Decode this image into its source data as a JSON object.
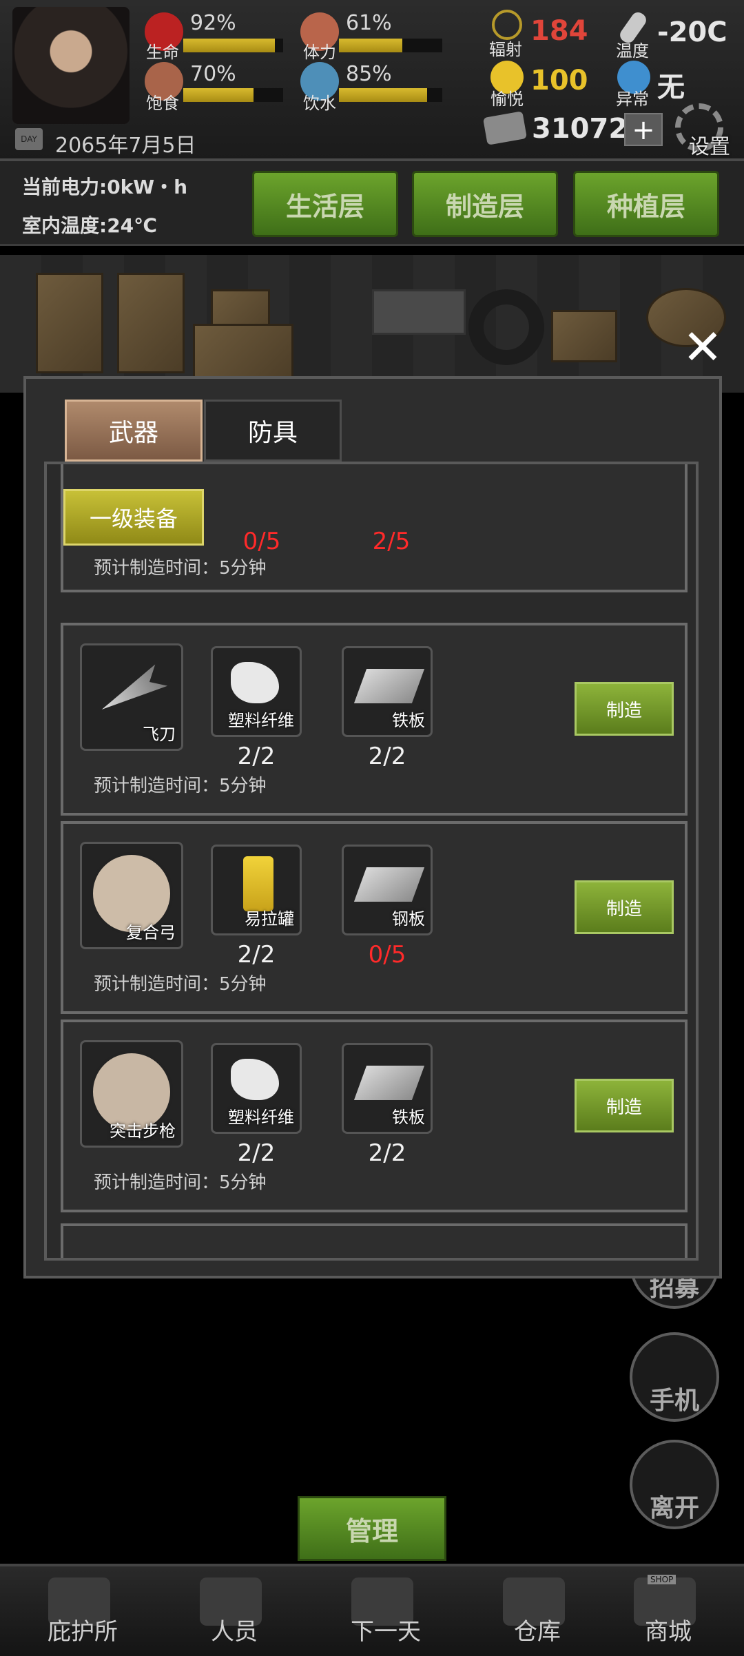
{
  "status": {
    "stats": [
      {
        "label": "生命",
        "percent": "92%",
        "level": 0.92,
        "color": "#c33"
      },
      {
        "label": "体力",
        "percent": "61%",
        "level": 0.61,
        "color": "#c0644a"
      },
      {
        "label": "饱食",
        "percent": "70%",
        "level": 0.7,
        "color": "#b4694a"
      },
      {
        "label": "饮水",
        "percent": "85%",
        "level": 0.85,
        "color": "#5a9fc8"
      }
    ],
    "radiation": {
      "label": "辐射",
      "value": "184"
    },
    "temperature": {
      "label": "温度",
      "value": "-20C"
    },
    "mood": {
      "label": "愉悦",
      "value": "100"
    },
    "abnormal": {
      "label": "异常",
      "value": "无"
    },
    "money": "31072",
    "add_label": "+",
    "settings_label": "设置",
    "date": "2065年7月5日",
    "day_label": "DAY"
  },
  "info": {
    "power": "当前电力:0kW・h",
    "indoor_temp": "室内温度:24℃"
  },
  "floors": [
    "生活层",
    "制造层",
    "种植层"
  ],
  "side_buttons": [
    "招募",
    "手机",
    "离开"
  ],
  "modal": {
    "close": "✕",
    "tabs": [
      "武器",
      "防具"
    ],
    "tier_button": "一级装备",
    "partial_card": {
      "qty_a": "0/5",
      "qty_b": "2/5",
      "time": "预计制造时间：5分钟"
    },
    "recipes": [
      {
        "item": "飞刀",
        "materials": [
          {
            "name": "塑料纤维",
            "qty": "2/2",
            "ok": true
          },
          {
            "name": "铁板",
            "qty": "2/2",
            "ok": true
          }
        ],
        "time": "预计制造时间：5分钟",
        "button": "制造"
      },
      {
        "item": "复合弓",
        "materials": [
          {
            "name": "易拉罐",
            "qty": "2/2",
            "ok": true
          },
          {
            "name": "钢板",
            "qty": "0/5",
            "ok": false
          }
        ],
        "time": "预计制造时间：5分钟",
        "button": "制造"
      },
      {
        "item": "突击步枪",
        "materials": [
          {
            "name": "塑料纤维",
            "qty": "2/2",
            "ok": true
          },
          {
            "name": "铁板",
            "qty": "2/2",
            "ok": true
          }
        ],
        "time": "预计制造时间：5分钟",
        "button": "制造"
      }
    ]
  },
  "manage_button": "管理",
  "bottom_nav": [
    "庇护所",
    "人员",
    "下一天",
    "仓库",
    "商城"
  ],
  "shop_badge": "SHOP",
  "colors": {
    "radiation": "#e0453a",
    "mood": "#e8c22a",
    "green_button": "#5b8f24",
    "shortage": "#ff2a2a"
  }
}
